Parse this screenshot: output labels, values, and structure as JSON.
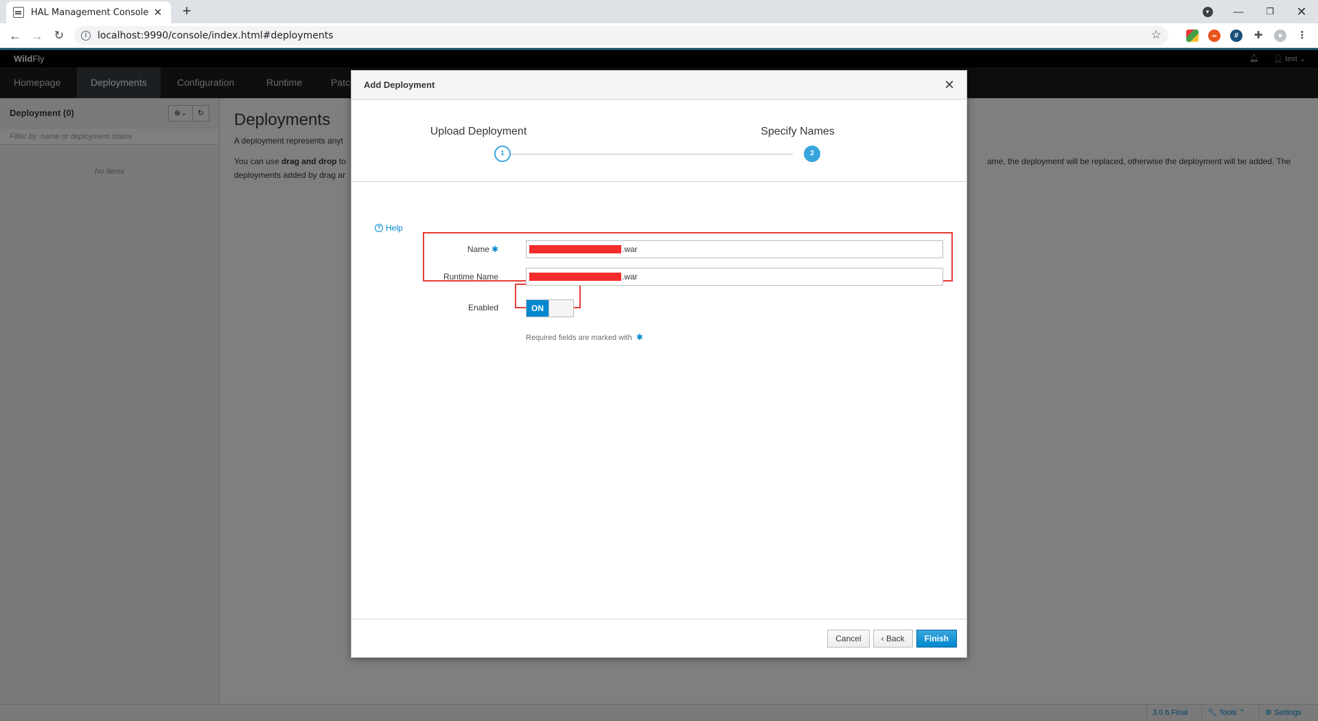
{
  "browser": {
    "tab_title": "HAL Management Console",
    "url": "localhost:9990/console/index.html#deployments"
  },
  "app": {
    "brand_bold": "Wild",
    "brand_light": "Fly",
    "user": "test",
    "nav": [
      "Homepage",
      "Deployments",
      "Configuration",
      "Runtime",
      "Patc"
    ],
    "accent": "#39a5dc"
  },
  "sidebar": {
    "title": "Deployment (0)",
    "filter_placeholder": "Filter by: name or deployment status",
    "empty_text": "No items"
  },
  "main": {
    "title": "Deployments",
    "desc_line1": "A deployment represents anyt",
    "desc_pre": "You can use ",
    "desc_bold": "drag and drop",
    "desc_mid": " to",
    "desc_tail": "ame, the deployment will be replaced, otherwise the deployment will be added. The",
    "desc_line3": "deployments added by drag ar"
  },
  "statusbar": {
    "version": "3.0.6.Final",
    "tools": "Tools",
    "settings": "Settings"
  },
  "modal": {
    "title": "Add Deployment",
    "steps": [
      {
        "label": "Upload Deployment",
        "number": "1"
      },
      {
        "label": "Specify Names",
        "number": "2"
      }
    ],
    "help": "Help",
    "fields": {
      "name_label": "Name",
      "name_suffix": ".war",
      "runtime_label": "Runtime Name",
      "runtime_suffix": ".war",
      "enabled_label": "Enabled",
      "toggle_on": "ON"
    },
    "required_note": "Required fields are marked with",
    "buttons": {
      "cancel": "Cancel",
      "back": "Back",
      "finish": "Finish"
    }
  }
}
